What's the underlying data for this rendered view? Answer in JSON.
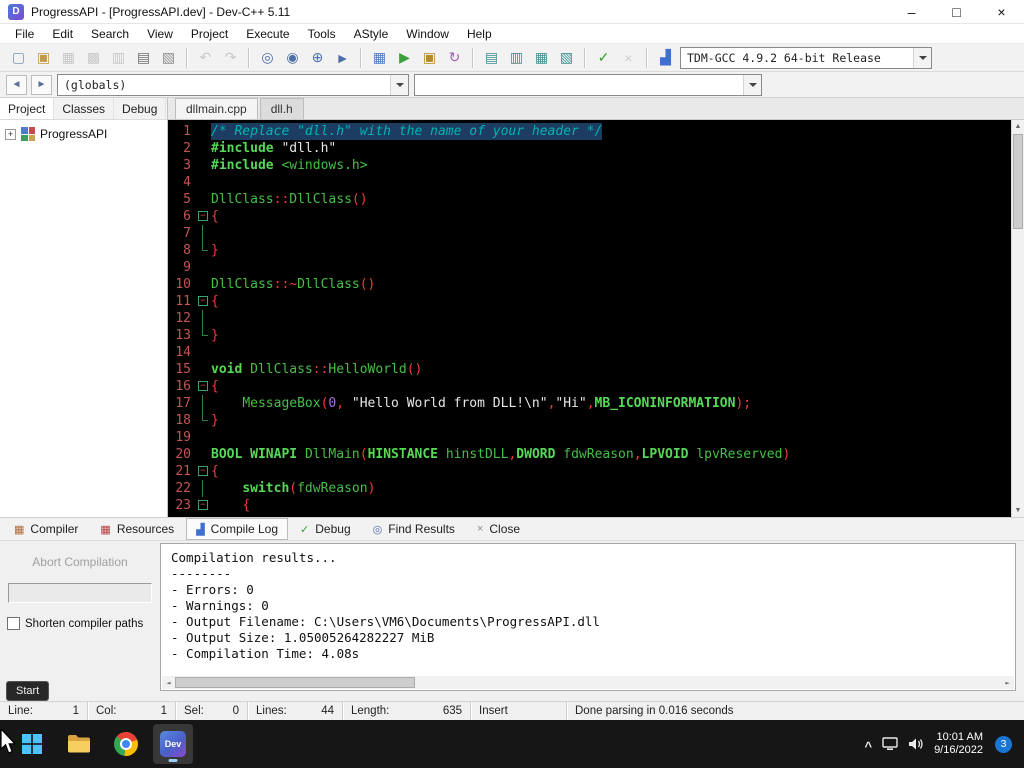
{
  "icons": {
    "minimize": "–",
    "maximize": "□",
    "close": "×",
    "expander": "+",
    "fold_minus": "−",
    "scroll_up": "▲",
    "scroll_down": "▼",
    "scroll_left": "◄",
    "scroll_right": "►",
    "tray_chevron": "^",
    "devcpp_logo_text": "Dev",
    "app_logo_text": "D"
  },
  "titlebar": {
    "title": "ProgressAPI - [ProgressAPI.dev] - Dev-C++ 5.11"
  },
  "menubar": [
    "File",
    "Edit",
    "Search",
    "View",
    "Project",
    "Execute",
    "Tools",
    "AStyle",
    "Window",
    "Help"
  ],
  "toolbar": {
    "compiler": "TDM-GCC 4.9.2 64-bit Release",
    "groups": [
      [
        {
          "name": "new-source-icon",
          "g": "▢",
          "c": "#7d96b8"
        },
        {
          "name": "open-project-icon",
          "g": "▣",
          "c": "#c2994d"
        },
        {
          "name": "save-icon",
          "g": "▦",
          "c": "#8f8f8f",
          "d": true
        },
        {
          "name": "save-all-icon",
          "g": "▩",
          "c": "#8f8f8f",
          "d": true
        },
        {
          "name": "close-file-icon",
          "g": "▥",
          "c": "#8f8f8f",
          "d": true
        },
        {
          "name": "print-icon",
          "g": "▤",
          "c": "#6e6e6e"
        },
        {
          "name": "print-setup-icon",
          "g": "▧",
          "c": "#8d8d8d"
        }
      ],
      [
        {
          "name": "undo-icon",
          "g": "↶",
          "c": "#8f8f8f",
          "d": true
        },
        {
          "name": "redo-icon",
          "g": "↷",
          "c": "#8f8f8f",
          "d": true
        }
      ],
      [
        {
          "name": "find-icon",
          "g": "◎",
          "c": "#4d6fa8"
        },
        {
          "name": "replace-icon",
          "g": "◉",
          "c": "#4d6fa8"
        },
        {
          "name": "find-next-icon",
          "g": "⊕",
          "c": "#4d6fa8"
        },
        {
          "name": "goto-line-icon",
          "g": "►",
          "c": "#4d6fa8"
        }
      ],
      [
        {
          "name": "compile-icon",
          "g": "▦",
          "c": "#4d79c7"
        },
        {
          "name": "run-icon",
          "g": "▶",
          "c": "#3d9e3d"
        },
        {
          "name": "compile-run-icon",
          "g": "▣",
          "c": "#b58a2e"
        },
        {
          "name": "rebuild-icon",
          "g": "↻",
          "c": "#9e5fb0"
        }
      ],
      [
        {
          "name": "toggle-project-view-icon",
          "g": "▤",
          "c": "#3f8f8f"
        },
        {
          "name": "toggle-report-view-icon",
          "g": "▥",
          "c": "#3f8f8f"
        },
        {
          "name": "split-window-icon",
          "g": "▦",
          "c": "#3f8f8f"
        },
        {
          "name": "fullscreen-icon",
          "g": "▧",
          "c": "#3f8f8f"
        }
      ],
      [
        {
          "name": "format-astyle-icon",
          "g": "✓",
          "c": "#2f9e2f"
        },
        {
          "name": "stop-icon",
          "g": "×",
          "c": "#9a9a9a",
          "d": true
        }
      ],
      [
        {
          "name": "profile-analysis-icon",
          "g": "▟",
          "c": "#3f6fcf"
        },
        {
          "name": "delete-profiling-icon",
          "g": "⊘",
          "c": "#c23a3a"
        }
      ]
    ]
  },
  "navrow": {
    "buttons": [
      {
        "name": "goto-declaration-icon",
        "g": "◄"
      },
      {
        "name": "goto-definition-icon",
        "g": "►"
      }
    ],
    "globals": "(globals)",
    "members": ""
  },
  "left_panel": {
    "tabs": [
      {
        "label": "Project",
        "active": true
      },
      {
        "label": "Classes",
        "active": false
      },
      {
        "label": "Debug",
        "active": false
      }
    ],
    "root": "ProgressAPI"
  },
  "editor": {
    "tabs": [
      {
        "label": "dllmain.cpp",
        "active": true
      },
      {
        "label": "dll.h",
        "active": false
      }
    ],
    "code": [
      {
        "n": 1,
        "sel": true,
        "s": [
          [
            "/* Replace \"dll.h\" with the name of your header */",
            "c"
          ]
        ]
      },
      {
        "n": 2,
        "s": [
          [
            "#include",
            "k"
          ],
          [
            " ",
            "w"
          ],
          [
            "\"dll.h\"",
            "s"
          ]
        ]
      },
      {
        "n": 3,
        "s": [
          [
            "#include",
            "k"
          ],
          [
            " ",
            "w"
          ],
          [
            "<windows.h>",
            "i"
          ]
        ]
      },
      {
        "n": 4,
        "s": []
      },
      {
        "n": 5,
        "s": [
          [
            "DllClass",
            "i"
          ],
          [
            "::",
            "p"
          ],
          [
            "DllClass",
            "i"
          ],
          [
            "()",
            "p"
          ]
        ]
      },
      {
        "n": 6,
        "f": "box",
        "s": [
          [
            "{",
            "p"
          ]
        ]
      },
      {
        "n": 7,
        "f": "line",
        "s": []
      },
      {
        "n": 8,
        "f": "end",
        "s": [
          [
            "}",
            "p"
          ]
        ]
      },
      {
        "n": 9,
        "s": []
      },
      {
        "n": 10,
        "s": [
          [
            "DllClass",
            "i"
          ],
          [
            "::~",
            "p"
          ],
          [
            "DllClass",
            "i"
          ],
          [
            "()",
            "p"
          ]
        ]
      },
      {
        "n": 11,
        "f": "box",
        "s": [
          [
            "{",
            "p"
          ]
        ]
      },
      {
        "n": 12,
        "f": "line",
        "s": []
      },
      {
        "n": 13,
        "f": "end",
        "s": [
          [
            "}",
            "p"
          ]
        ]
      },
      {
        "n": 14,
        "s": []
      },
      {
        "n": 15,
        "s": [
          [
            "void",
            "k"
          ],
          [
            " ",
            "w"
          ],
          [
            "DllClass",
            "i"
          ],
          [
            "::",
            "p"
          ],
          [
            "HelloWorld",
            "i"
          ],
          [
            "()",
            "p"
          ]
        ]
      },
      {
        "n": 16,
        "f": "box",
        "s": [
          [
            "{",
            "p"
          ]
        ]
      },
      {
        "n": 17,
        "f": "line",
        "s": [
          [
            "    ",
            "w"
          ],
          [
            "MessageBox",
            "i"
          ],
          [
            "(",
            "p"
          ],
          [
            "0",
            "n"
          ],
          [
            ", ",
            "p"
          ],
          [
            "\"Hello World from DLL!\\n\"",
            "s"
          ],
          [
            ",",
            "p"
          ],
          [
            "\"Hi\"",
            "s"
          ],
          [
            ",",
            "p"
          ],
          [
            "MB_ICONINFORMATION",
            "k"
          ],
          [
            ");",
            "p"
          ]
        ]
      },
      {
        "n": 18,
        "f": "end",
        "s": [
          [
            "}",
            "p"
          ]
        ]
      },
      {
        "n": 19,
        "s": []
      },
      {
        "n": 20,
        "s": [
          [
            "BOOL",
            "k"
          ],
          [
            " ",
            "w"
          ],
          [
            "WINAPI",
            "k"
          ],
          [
            " ",
            "w"
          ],
          [
            "DllMain",
            "i"
          ],
          [
            "(",
            "p"
          ],
          [
            "HINSTANCE",
            "k"
          ],
          [
            " ",
            "w"
          ],
          [
            "hinstDLL",
            "i"
          ],
          [
            ",",
            "p"
          ],
          [
            "DWORD",
            "k"
          ],
          [
            " ",
            "w"
          ],
          [
            "fdwReason",
            "i"
          ],
          [
            ",",
            "p"
          ],
          [
            "LPVOID",
            "k"
          ],
          [
            " ",
            "w"
          ],
          [
            "lpvReserved",
            "i"
          ],
          [
            ")",
            "p"
          ]
        ]
      },
      {
        "n": 21,
        "f": "box",
        "s": [
          [
            "{",
            "p"
          ]
        ]
      },
      {
        "n": 22,
        "f": "line",
        "s": [
          [
            "    ",
            "w"
          ],
          [
            "switch",
            "k"
          ],
          [
            "(",
            "p"
          ],
          [
            "fdwReason",
            "i"
          ],
          [
            ")",
            "p"
          ]
        ]
      },
      {
        "n": 23,
        "f": "box",
        "s": [
          [
            "    ",
            "w"
          ],
          [
            "{",
            "p"
          ]
        ]
      }
    ]
  },
  "bottom_panel": {
    "tabs": [
      {
        "label": "Compiler",
        "icon": "compiler-tab-icon",
        "g": "▦",
        "c": "#b06a35",
        "active": false
      },
      {
        "label": "Resources",
        "icon": "resources-tab-icon",
        "g": "▦",
        "c": "#b03a3a",
        "active": false
      },
      {
        "label": "Compile Log",
        "icon": "compile-log-tab-icon",
        "g": "▟",
        "c": "#3f6fcf",
        "active": true
      },
      {
        "label": "Debug",
        "icon": "debug-tab-icon",
        "g": "✓",
        "c": "#2f9e2f",
        "active": false
      },
      {
        "label": "Find Results",
        "icon": "find-results-tab-icon",
        "g": "◎",
        "c": "#4d6fa8",
        "active": false
      },
      {
        "label": "Close",
        "icon": "close-tab-icon",
        "g": "×",
        "c": "#8a8a8a",
        "active": false
      }
    ],
    "abort_label": "Abort Compilation",
    "shorten_label": "Shorten compiler paths",
    "log_lines": [
      "Compilation results...",
      "--------",
      "- Errors: 0",
      "- Warnings: 0",
      "- Output Filename: C:\\Users\\VM6\\Documents\\ProgressAPI.dll",
      "- Output Size: 1.05005264282227 MiB",
      "- Compilation Time: 4.08s"
    ]
  },
  "statusbar": {
    "segments": [
      {
        "id": "line",
        "label": "Line:",
        "value": "1"
      },
      {
        "id": "col",
        "label": "Col:",
        "value": "1"
      },
      {
        "id": "sel",
        "label": "Sel:",
        "value": "0"
      },
      {
        "id": "lines",
        "label": "Lines:",
        "value": "44"
      },
      {
        "id": "length",
        "label": "Length:",
        "value": "635"
      },
      {
        "id": "insert",
        "label": "Insert",
        "value": ""
      },
      {
        "id": "parse",
        "label": "Done parsing in 0.016 seconds",
        "value": ""
      }
    ]
  },
  "taskbar": {
    "tooltip": "Start",
    "time": "10:01 AM",
    "date": "9/16/2022",
    "badge": "3"
  },
  "colors": {
    "accent_blue": "#1976d2",
    "editor_bg": "#000000",
    "selection_bg": "#1c3d61"
  }
}
